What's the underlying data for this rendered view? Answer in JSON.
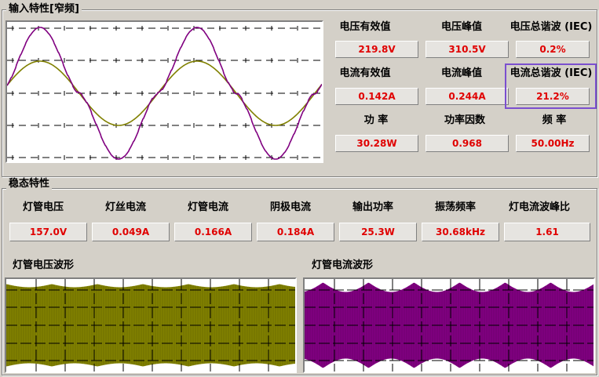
{
  "input": {
    "title": "输入特性[窄频]",
    "labels": {
      "voltage_rms": "电压有效值",
      "voltage_peak": "电压峰值",
      "voltage_thd": "电压总谐波 (IEC)",
      "current_rms": "电流有效值",
      "current_peak": "电流峰值",
      "current_thd": "电流总谐波 (IEC)",
      "power": "功  率",
      "power_factor": "功率因数",
      "frequency": "频  率"
    },
    "values": {
      "voltage_rms": "219.8V",
      "voltage_peak": "310.5V",
      "voltage_thd": "0.2%",
      "current_rms": "0.142A",
      "current_peak": "0.244A",
      "current_thd": "21.2%",
      "power": "30.28W",
      "power_factor": "0.968",
      "frequency": "50.00Hz"
    }
  },
  "steady": {
    "title": "稳态特性",
    "labels": [
      "灯管电压",
      "灯丝电流",
      "灯管电流",
      "阴极电流",
      "输出功率",
      "振荡频率",
      "灯电流波峰比"
    ],
    "values": [
      "157.0V",
      "0.049A",
      "0.166A",
      "0.184A",
      "25.3W",
      "30.68kHz",
      "1.61"
    ]
  },
  "waveforms": {
    "voltage_title": "灯管电压波形",
    "current_title": "灯管电流波形"
  },
  "colors": {
    "voltage_wave": "#808000",
    "current_wave": "#800080",
    "value_text": "#e00000",
    "highlight": "#7b4fcf"
  }
}
